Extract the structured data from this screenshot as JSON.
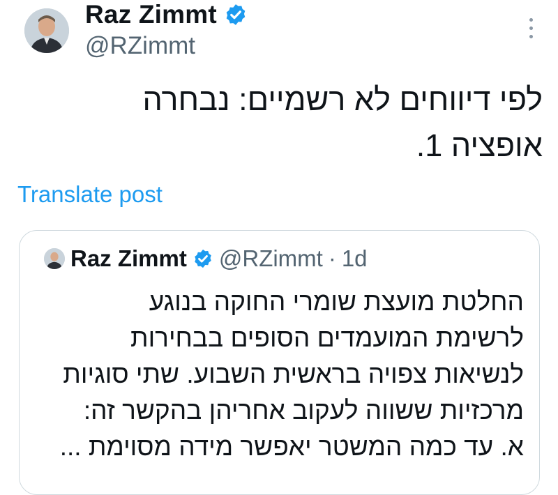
{
  "author": {
    "name": "Raz Zimmt",
    "handle": "@RZimmt",
    "verified_color": "#1d9bf0"
  },
  "post": {
    "text_lines": [
      "לפי דיווחים לא רשמיים: נבחרה",
      "אופציה 1."
    ],
    "translate_label": "Translate post",
    "more_icon": "more-vertical-icon"
  },
  "quoted_post": {
    "name": "Raz Zimmt",
    "handle": "@RZimmt",
    "separator": "·",
    "time": "1d",
    "text_lines": [
      "החלטת מועצת שומרי החוקה בנוגע",
      "לרשימת המועמדים הסופים בבחירות",
      "לנשיאות צפויה בראשית השבוע. שתי סוגיות",
      "מרכזיות ששווה לעקוב אחריהן בהקשר זה:",
      "א. עד כמה המשטר יאפשר מידה מסוימת ..."
    ]
  },
  "colors": {
    "link": "#1d9bf0",
    "secondary_text": "#536471",
    "border": "#cfd9de"
  }
}
